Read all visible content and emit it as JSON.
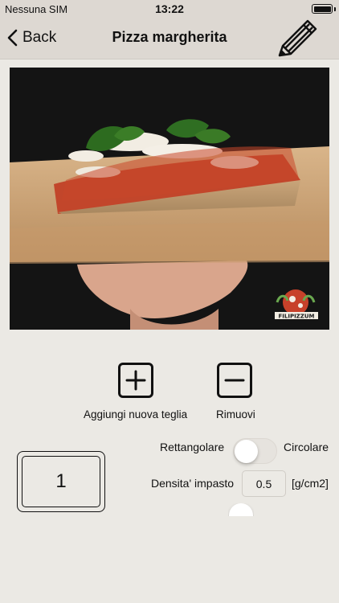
{
  "status_bar": {
    "carrier": "Nessuna SIM",
    "time": "13:22",
    "battery_level": 1.0
  },
  "nav": {
    "back_label": "Back",
    "title": "Pizza margherita",
    "edit_icon": "pencil-icon"
  },
  "photo": {
    "watermark_text": "FILIPIZZUM"
  },
  "actions": {
    "add_label": "Aggiungi nuova teglia",
    "remove_label": "Rimuovi"
  },
  "tray": {
    "count": "1"
  },
  "shape": {
    "left_label": "Rettangolare",
    "right_label": "Circolare",
    "selected": "Rettangolare"
  },
  "density": {
    "label": "Densita' impasto",
    "value": "0.5",
    "unit": "[g/cm2]"
  },
  "colors": {
    "background": "#ebe9e4",
    "bar": "#ddd8d2"
  }
}
